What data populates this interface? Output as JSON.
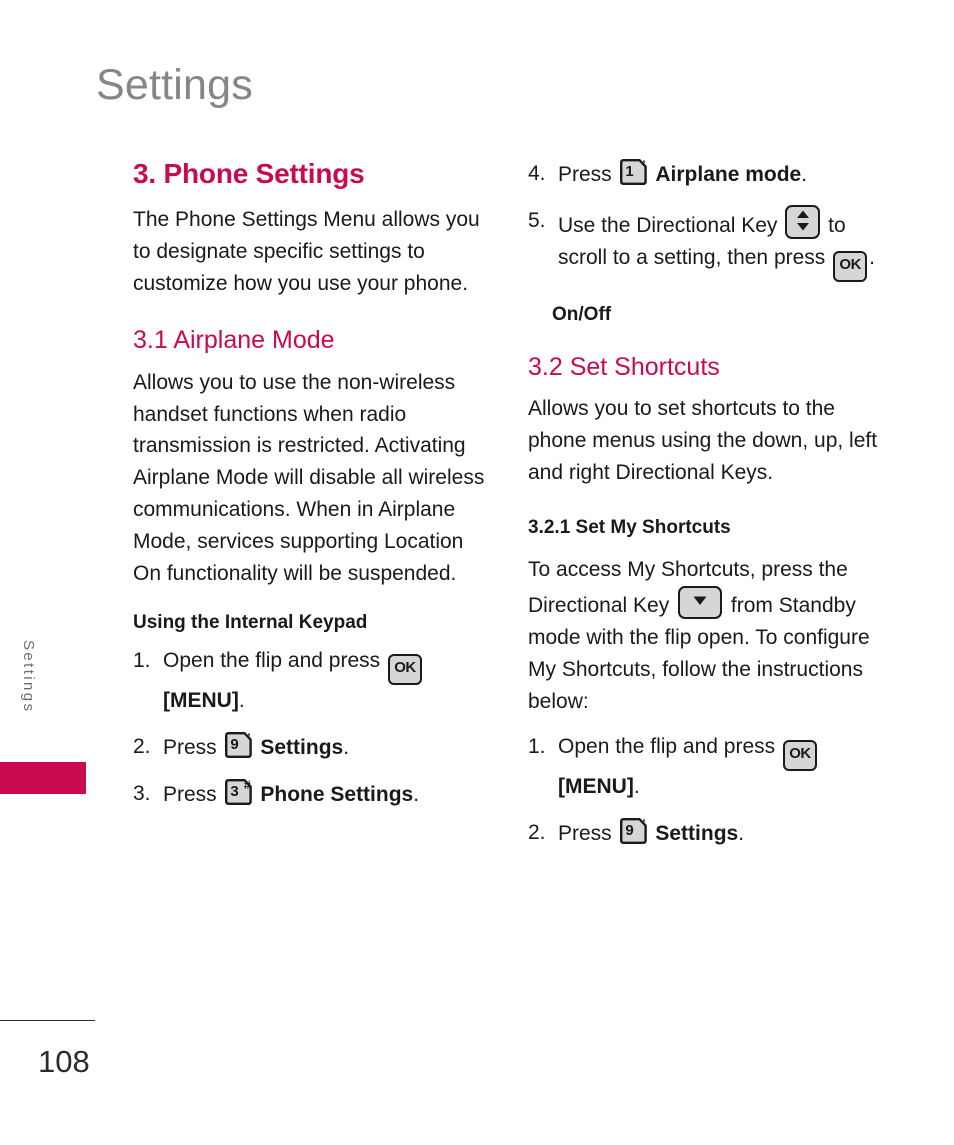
{
  "running_head": "Settings",
  "side_tab": {
    "label": "Settings",
    "block_color": "#c80a50"
  },
  "footer": {
    "page_number": "108"
  },
  "colors": {
    "accent": "#c80a50",
    "heading_gray": "#85868a",
    "body": "#1a1a1a",
    "key_fill": "#d6d6d6"
  },
  "left_column": {
    "section_heading": "3. Phone Settings",
    "intro": "The Phone Settings Menu allows you to designate specific settings to customize how you use your phone.",
    "subsection_heading": "3.1 Airplane Mode",
    "airplane_body": "Allows you to use the non-wireless handset functions when radio transmission is restricted. Activating Airplane Mode will disable all wireless communications. When in Airplane Mode, services supporting Location On functionality will be suspended.",
    "keypad_heading": "Using the Internal Keypad",
    "steps": [
      {
        "num": "1.",
        "before": "Open the flip and press",
        "key": "OK",
        "after": "",
        "after_bold": "[MENU]",
        "tail": "."
      },
      {
        "num": "2.",
        "before": "Press",
        "key": "9",
        "key_mark": "’",
        "after_bold": "Settings",
        "tail": "."
      },
      {
        "num": "3.",
        "before": "Press",
        "key": "3",
        "key_mark": "#",
        "after_bold": "Phone Settings",
        "tail": "."
      }
    ]
  },
  "right_column": {
    "steps_continued": [
      {
        "num": "4.",
        "before": "Press",
        "key": "1",
        "key_mark": "’",
        "after_bold": "Airplane mode",
        "tail": "."
      },
      {
        "num": "5.",
        "before": "Use the Directional Key",
        "key": "up-down",
        "middle": "to scroll to a setting, then press",
        "key2": "OK",
        "tail": "."
      }
    ],
    "onoff_label": "On/Off",
    "subsection_heading": "3.2 Set Shortcuts",
    "shortcuts_body": "Allows you to set shortcuts to the phone menus using the down, up, left and right Directional Keys.",
    "subsubsection_heading": "3.2.1 Set My Shortcuts",
    "my_shortcuts_body_1": "To access My Shortcuts, press the Directional Key",
    "my_shortcuts_body_2": "from Standby mode with the flip open. To configure My Shortcuts, follow the instructions below:",
    "steps": [
      {
        "num": "1.",
        "before": "Open the flip and press",
        "key": "OK",
        "after_bold": "[MENU]",
        "tail": "."
      },
      {
        "num": "2.",
        "before": "Press",
        "key": "9",
        "key_mark": "’",
        "after_bold": "Settings",
        "tail": "."
      }
    ]
  },
  "icons": {
    "ok_key": "ok-key-icon",
    "num_key": "numeric-key-icon",
    "up_down_key": "direction-key-up-down-icon",
    "down_key": "direction-key-down-icon"
  }
}
